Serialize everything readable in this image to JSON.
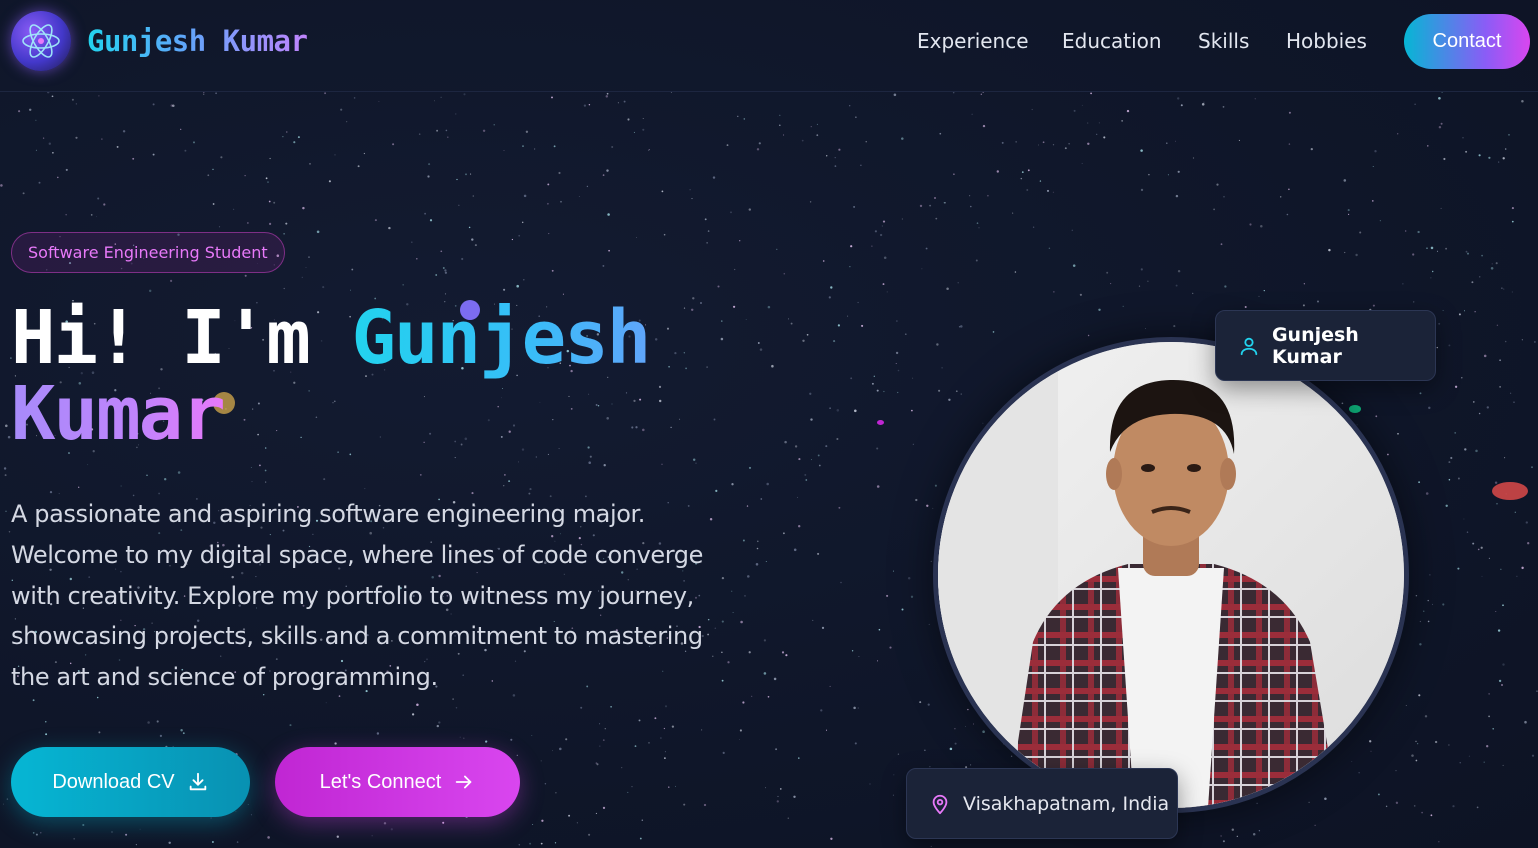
{
  "header": {
    "brand": "Gunjesh Kumar",
    "logo_icon": "atom-logo-icon",
    "nav": [
      "Experience",
      "Education",
      "Skills",
      "Hobbies"
    ],
    "contact_label": "Contact"
  },
  "hero": {
    "badge": "Software Engineering Student",
    "greeting": "Hi! I'm",
    "first_name": "Gunjesh",
    "last_name": "Kumar",
    "bio": "A passionate and aspiring software engineering major. Welcome to my digital space, where lines of code converge with creativity. Explore my portfolio to witness my journey, showcasing projects, skills and a commitment to mastering the art and science of programming.",
    "download_cv_label": "Download CV",
    "download_icon": "download-icon",
    "connect_label": "Let's Connect",
    "connect_icon": "arrow-right-icon"
  },
  "profile": {
    "name": "Gunjesh Kumar",
    "name_icon": "user-icon",
    "location": "Visakhapatnam, India",
    "location_icon": "map-pin-icon"
  },
  "colors": {
    "background": "#0f1629",
    "accent_cyan": "#06b6d4",
    "accent_purple": "#8b5cf6",
    "accent_magenta": "#d946ef"
  }
}
